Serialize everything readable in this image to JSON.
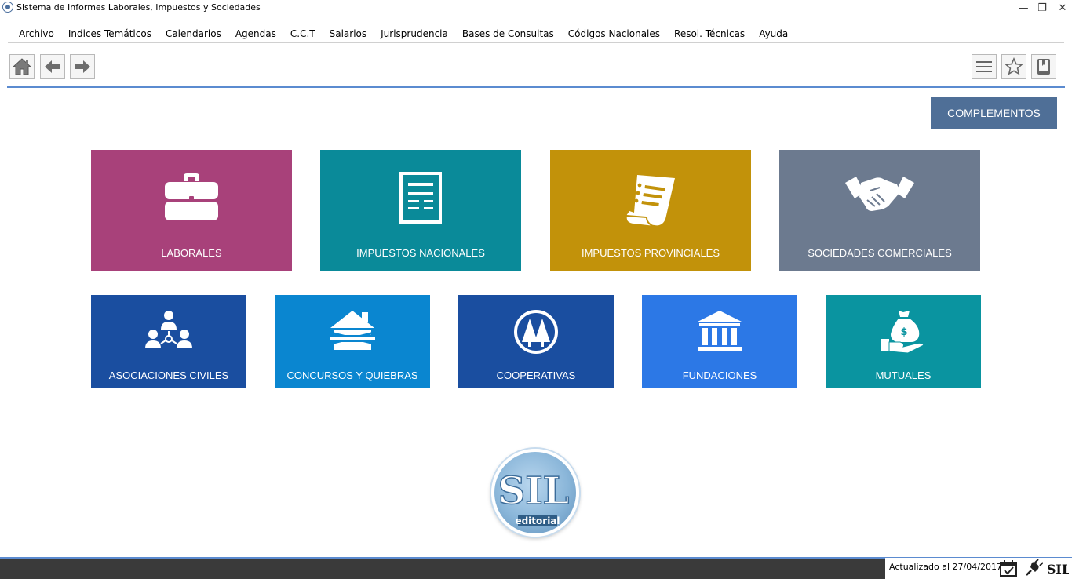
{
  "window": {
    "title": "Sistema de Informes Laborales, Impuestos y Sociedades",
    "minimize_glyph": "—",
    "restore_glyph": "❐",
    "close_glyph": "✕"
  },
  "menu": {
    "items": [
      "Archivo",
      "Indices Temáticos",
      "Calendarios",
      "Agendas",
      "C.C.T",
      "Salarios",
      "Jurisprudencia",
      "Bases de Consultas",
      "Códigos Nacionales",
      "Resol. Técnicas",
      "Ayuda"
    ]
  },
  "toolbar": {
    "left_icons": [
      "home-icon",
      "arrow-left-icon",
      "arrow-right-icon"
    ],
    "right_icons": [
      "hamburger-menu-icon",
      "star-icon",
      "book-icon"
    ]
  },
  "complementos_label": "COMPLEMENTOS",
  "tiles_row1": [
    {
      "label": "LABORALES",
      "icon": "briefcase-icon",
      "color": "#a8417a"
    },
    {
      "label": "IMPUESTOS NACIONALES",
      "icon": "document-icon",
      "color": "#0a8a99"
    },
    {
      "label": "IMPUESTOS PROVINCIALES",
      "icon": "receipt-scroll-icon",
      "color": "#c2920a"
    },
    {
      "label": "SOCIEDADES COMERCIALES",
      "icon": "handshake-icon",
      "color": "#6c7a8f"
    }
  ],
  "tiles_row2": [
    {
      "label": "ASOCIACIONES CIVILES",
      "icon": "people-network-icon",
      "color": "#1a4ea0"
    },
    {
      "label": "CONCURSOS Y QUIEBRAS",
      "icon": "boarded-house-icon",
      "color": "#0a86d0"
    },
    {
      "label": "COOPERATIVAS",
      "icon": "pine-trees-icon",
      "color": "#1a4ea0"
    },
    {
      "label": "FUNDACIONES",
      "icon": "institution-building-icon",
      "color": "#2c78e6"
    },
    {
      "label": "MUTUALES",
      "icon": "money-bag-hand-icon",
      "color": "#0a94a0"
    }
  ],
  "logo": {
    "text": "SIL",
    "subtext": "editorial"
  },
  "status": {
    "updated_text": "Actualizado al 27/04/2017",
    "icons": [
      "calendar-check-icon",
      "plug-icon",
      "sil-logo-icon"
    ]
  }
}
